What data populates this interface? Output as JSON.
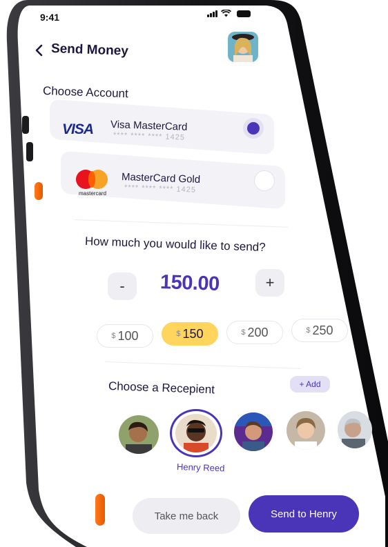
{
  "status_bar": {
    "time": "9:41"
  },
  "header": {
    "title": "Send Money"
  },
  "accounts": {
    "section_title": "Choose Account",
    "cards": [
      {
        "brand": "VISA",
        "name": "Visa MasterCard",
        "number": "**** **** **** 1425",
        "selected": true
      },
      {
        "brand": "mastercard",
        "name": "MasterCard Gold",
        "number": "**** **** **** 1425",
        "selected": false
      }
    ]
  },
  "amount": {
    "question": "How much you would like to send?",
    "minus_label": "-",
    "plus_label": "+",
    "value": "150.00",
    "currency_symbol": "$",
    "presets": [
      "100",
      "150",
      "200",
      "250"
    ],
    "selected_preset": "150"
  },
  "recipients": {
    "section_title": "Choose a Recepient",
    "add_label": "+ Add",
    "selected_name": "Henry Reed"
  },
  "actions": {
    "back_label": "Take me back",
    "send_label": "Send to Henry"
  },
  "colors": {
    "accent": "#4a34b8",
    "chip_selected": "#ffd55e",
    "phone_button": "#ff7a1a"
  }
}
